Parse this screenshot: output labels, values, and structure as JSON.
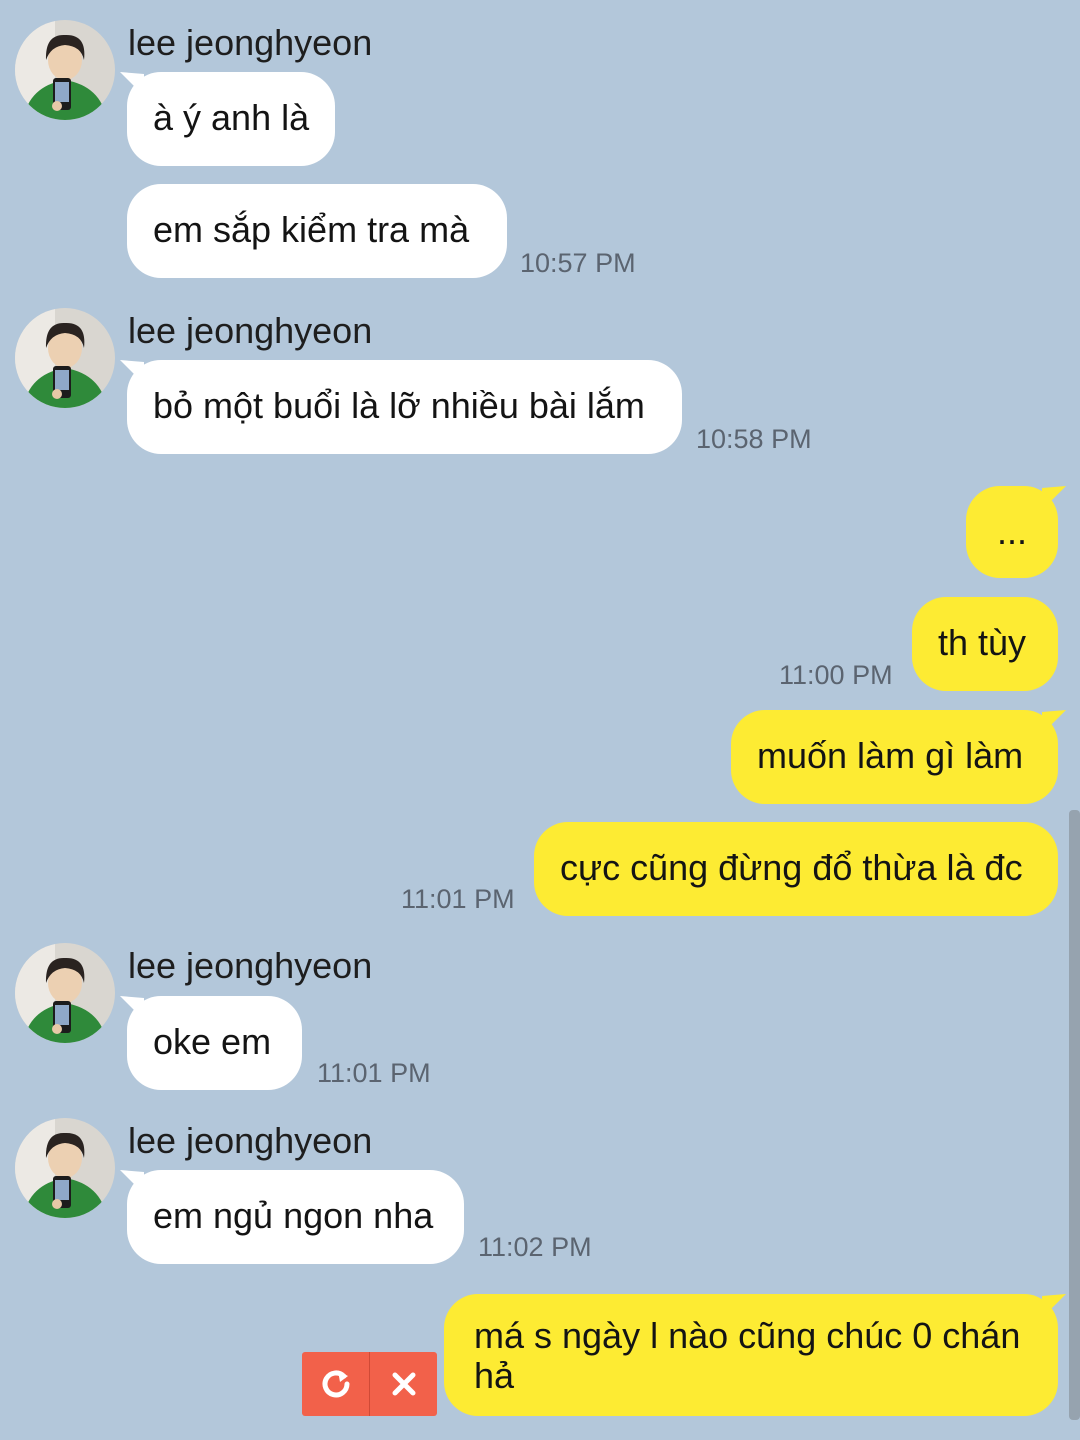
{
  "chat": {
    "colors": {
      "background": "#b3c7da",
      "incoming_bubble": "#ffffff",
      "outgoing_bubble": "#fdeb33",
      "failed_action": "#f2614a"
    },
    "sender_name": "lee jeonghyeon",
    "groups": [
      {
        "sender": "lee jeonghyeon",
        "messages": [
          "à ý anh là",
          "em sắp kiểm tra mà"
        ],
        "time": "10:57 PM"
      },
      {
        "sender": "lee jeonghyeon",
        "messages": [
          "bỏ một buổi là lỡ nhiều bài lắm"
        ],
        "time": "10:58 PM"
      },
      {
        "sender": "me",
        "messages": [
          "...",
          "th tùy"
        ],
        "time": "11:00 PM"
      },
      {
        "sender": "me",
        "messages": [
          "muốn làm gì làm",
          "cực cũng đừng đổ thừa là đc"
        ],
        "time": "11:01 PM"
      },
      {
        "sender": "lee jeonghyeon",
        "messages": [
          "oke em"
        ],
        "time": "11:01 PM"
      },
      {
        "sender": "lee jeonghyeon",
        "messages": [
          "em ngủ ngon nha"
        ],
        "time": "11:02 PM"
      },
      {
        "sender": "me",
        "messages": [
          "má s ngày l nào cũng chúc 0 chán hả"
        ],
        "status": "failed",
        "actions": [
          "retry-icon",
          "delete-icon"
        ]
      }
    ]
  }
}
